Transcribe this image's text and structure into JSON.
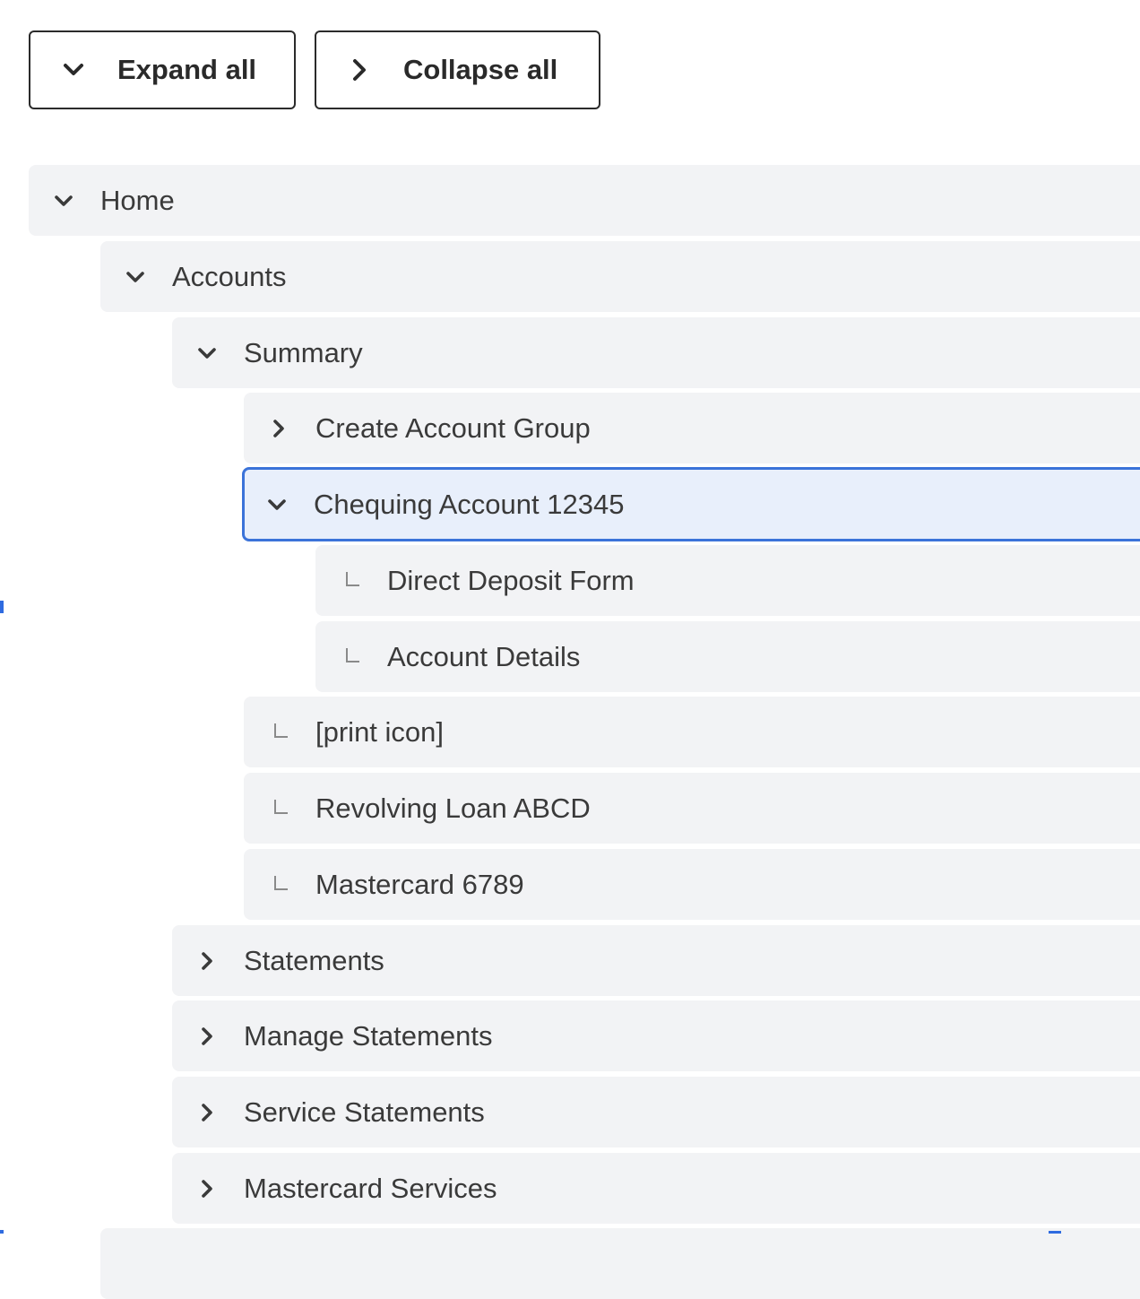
{
  "toolbar": {
    "expand_label": "Expand all",
    "collapse_label": "Collapse all"
  },
  "tree": [
    {
      "label": "Home",
      "icon": "chevron-down-icon",
      "depth": 0
    },
    {
      "label": "Accounts",
      "icon": "chevron-down-icon",
      "depth": 1
    },
    {
      "label": "Summary",
      "icon": "chevron-down-icon",
      "depth": 2
    },
    {
      "label": "Create Account Group",
      "icon": "chevron-right-icon",
      "depth": 3
    },
    {
      "label": "Chequing Account 12345",
      "icon": "chevron-down-icon",
      "depth": 3,
      "selected": true
    },
    {
      "label": "Direct Deposit Form",
      "icon": "leaf-connector-icon",
      "depth": 4
    },
    {
      "label": "Account Details",
      "icon": "leaf-connector-icon",
      "depth": 4
    },
    {
      "label": "[print icon]",
      "icon": "leaf-connector-icon",
      "depth": 3
    },
    {
      "label": "Revolving Loan ABCD",
      "icon": "leaf-connector-icon",
      "depth": 3
    },
    {
      "label": "Mastercard 6789",
      "icon": "leaf-connector-icon",
      "depth": 3
    },
    {
      "label": "Statements",
      "icon": "chevron-right-icon",
      "depth": 2
    },
    {
      "label": "Manage Statements",
      "icon": "chevron-right-icon",
      "depth": 2
    },
    {
      "label": "Service Statements",
      "icon": "chevron-right-icon",
      "depth": 2
    },
    {
      "label": "Mastercard Services",
      "icon": "chevron-right-icon",
      "depth": 2
    }
  ],
  "colors": {
    "row_bg": "#f2f3f5",
    "selected_bg": "#e8effb",
    "selected_border": "#3b73d9",
    "accent": "#2f6be0"
  }
}
